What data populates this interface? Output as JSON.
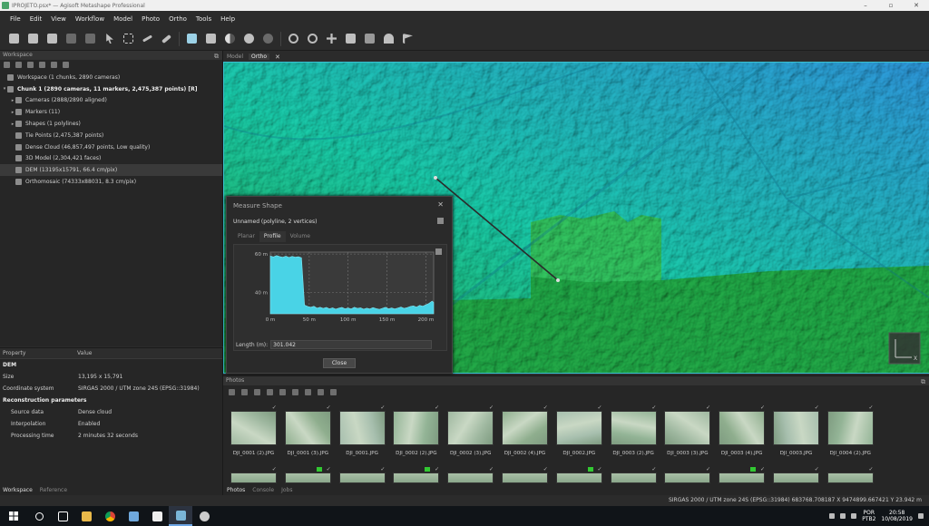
{
  "window": {
    "title": "IPROJETO.psx* — Agisoft Metashape Professional",
    "buttons": [
      "–",
      "▫",
      "✕"
    ]
  },
  "menu": [
    "File",
    "Edit",
    "View",
    "Workflow",
    "Model",
    "Photo",
    "Ortho",
    "Tools",
    "Help"
  ],
  "workspace": {
    "pane_title": "Workspace",
    "items": [
      {
        "label": "Workspace (1 chunks, 2890 cameras)",
        "level": 0,
        "arrow": "",
        "bold": false
      },
      {
        "label": "Chunk 1 (2890 cameras, 11 markers, 2,475,387 points) [R]",
        "level": 0,
        "arrow": "▾",
        "bold": true
      },
      {
        "label": "Cameras (2888/2890 aligned)",
        "level": 1,
        "arrow": "▸",
        "bold": false
      },
      {
        "label": "Markers (11)",
        "level": 1,
        "arrow": "▸",
        "bold": false
      },
      {
        "label": "Shapes (1 polylines)",
        "level": 1,
        "arrow": "▸",
        "bold": false
      },
      {
        "label": "Tie Points (2,475,387 points)",
        "level": 1,
        "arrow": "",
        "bold": false
      },
      {
        "label": "Dense Cloud (46,857,497 points, Low quality)",
        "level": 1,
        "arrow": "",
        "bold": false
      },
      {
        "label": "3D Model (2,304,421 faces)",
        "level": 1,
        "arrow": "",
        "bold": false
      },
      {
        "label": "DEM (13195x15791, 66.4 cm/pix)",
        "level": 1,
        "arrow": "",
        "bold": false,
        "selected": true
      },
      {
        "label": "Orthomosaic (74333x88031, 8.3 cm/pix)",
        "level": 1,
        "arrow": "",
        "bold": false
      }
    ]
  },
  "properties": {
    "headers": [
      "Property",
      "Value"
    ],
    "rows": [
      {
        "k": "DEM",
        "v": "",
        "section": true
      },
      {
        "k": "Size",
        "v": "13,195 x 15,791"
      },
      {
        "k": "Coordinate system",
        "v": "SIRGAS 2000 / UTM zone 24S (EPSG::31984)"
      },
      {
        "k": "Reconstruction parameters",
        "v": "",
        "section": true
      },
      {
        "k": "Source data",
        "v": "Dense cloud",
        "indent": true
      },
      {
        "k": "Interpolation",
        "v": "Enabled",
        "indent": true
      },
      {
        "k": "Processing time",
        "v": "2 minutes 32 seconds",
        "indent": true
      }
    ]
  },
  "left_tabs": [
    "Workspace",
    "Reference"
  ],
  "view_tabs": [
    "Model",
    "Ortho"
  ],
  "measure": {
    "title": "Measure Shape",
    "shape": "Unnamed (polyline, 2 vertices)",
    "tabs": [
      "Planar",
      "Profile",
      "Volume"
    ],
    "active_tab": "Profile",
    "length_label": "Length (m):",
    "length_value": "301.042",
    "close_label": "Close"
  },
  "chart_data": {
    "type": "area",
    "x_unit": "m",
    "xlim": [
      0,
      210
    ],
    "ylim": [
      29,
      61
    ],
    "x_ticks": [
      "0 m",
      "50 m",
      "100 m",
      "150 m",
      "200 m"
    ],
    "y_ticks": [
      "60 m",
      "40 m"
    ],
    "x": [
      0,
      4,
      8,
      12,
      16,
      20,
      24,
      28,
      32,
      36,
      40,
      44,
      48,
      52,
      56,
      60,
      64,
      68,
      72,
      76,
      80,
      84,
      88,
      92,
      96,
      100,
      104,
      108,
      112,
      116,
      120,
      124,
      128,
      132,
      136,
      140,
      144,
      148,
      152,
      156,
      160,
      164,
      168,
      172,
      176,
      180,
      184,
      188,
      192,
      196,
      200,
      204,
      208,
      210
    ],
    "y": [
      59,
      58.5,
      59.2,
      58.7,
      58.3,
      58.9,
      58.2,
      58.8,
      58.4,
      58.6,
      58.1,
      33.5,
      32.8,
      32.4,
      32.9,
      31.9,
      32.4,
      31.8,
      32.3,
      31.6,
      32.1,
      31.4,
      31.9,
      32.3,
      31.6,
      32.0,
      31.5,
      32.4,
      31.8,
      32.1,
      31.4,
      31.9,
      31.5,
      32.2,
      31.7,
      31.3,
      31.8,
      32.4,
      31.6,
      32.0,
      31.5,
      32.0,
      32.5,
      31.8,
      32.2,
      32.8,
      33.1,
      32.5,
      33.4,
      32.9,
      33.6,
      34.4,
      35.6,
      34.9
    ]
  },
  "photos": {
    "pane_title": "Photos",
    "tabs": [
      "Photos",
      "Console",
      "Jobs"
    ],
    "thumbs": [
      "DJI_0001 (2).JPG",
      "DJI_0001 (3).JPG",
      "DJI_0001.JPG",
      "DJI_0002 (2).JPG",
      "DJI_0002 (3).JPG",
      "DJI_0002 (4).JPG",
      "DJI_0002.JPG",
      "DJI_0003 (2).JPG",
      "DJI_0003 (3).JPG",
      "DJI_0003 (4).JPG",
      "DJI_0003.JPG",
      "DJI_0004 (2).JPG"
    ],
    "row2_flags": [
      false,
      true,
      false,
      true,
      false,
      false,
      true,
      false,
      false,
      true,
      false,
      false
    ],
    "checkmark": "✓"
  },
  "status": "SIRGAS 2000 / UTM zone 24S (EPSG::31984)   683768.708187 X   9474899.667421 Y   23.942 m",
  "tray": {
    "lang": "POR",
    "kbd": "PTB2",
    "time": "20:58",
    "date": "10/08/2019"
  },
  "colors": {
    "dem_low": "#1fa043",
    "dem_mid": "#18c0a0",
    "dem_high": "#2b8fd0",
    "profile_fill": "#49d3e6",
    "accent": "#3ac0d0"
  },
  "icons": [
    "new-icon",
    "open-icon",
    "save-icon",
    "undo-icon",
    "redo-icon",
    "pointer-icon",
    "rect-select-icon",
    "polyline-icon",
    "ruler-icon",
    "shape-icon",
    "grid-icon",
    "contrast-icon",
    "palette-icon",
    "settings-icon",
    "zoom-in-icon",
    "zoom-out-icon",
    "move-icon",
    "image-icon",
    "tile-icon",
    "heart-icon",
    "flag-icon"
  ]
}
